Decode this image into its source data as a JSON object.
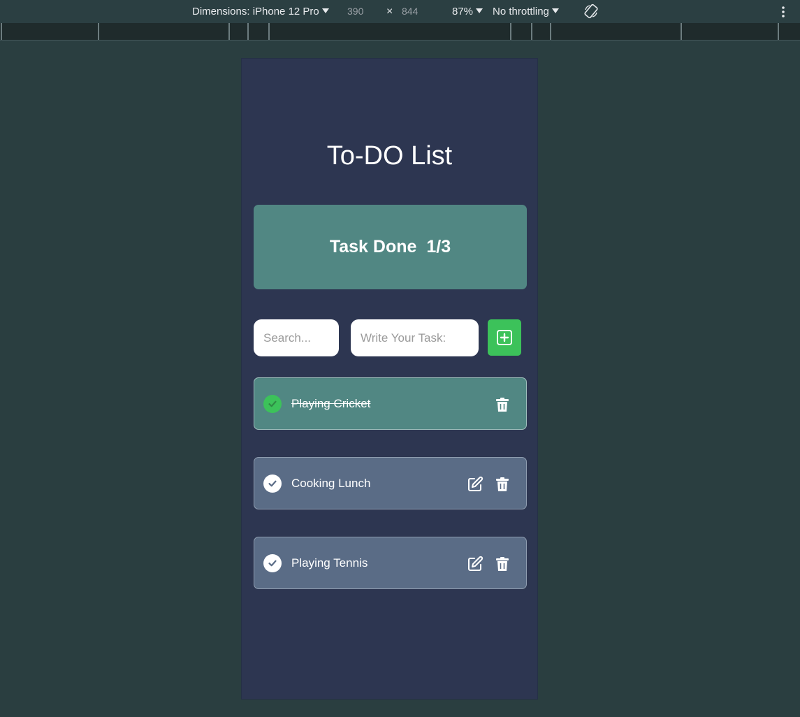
{
  "devtools": {
    "dimensions_label": "Dimensions: iPhone 12 Pro",
    "width": "390",
    "times": "×",
    "height": "844",
    "zoom": "87%",
    "throttling": "No throttling"
  },
  "app": {
    "title": "To-DO List",
    "stats": {
      "label": "Task Done",
      "count": "1/3"
    },
    "search": {
      "placeholder": "Search...",
      "value": ""
    },
    "task_input": {
      "placeholder": "Write Your Task:",
      "value": ""
    },
    "add_icon": "plus-square-icon",
    "tasks": [
      {
        "text": "Playing Cricket",
        "done": true
      },
      {
        "text": "Cooking Lunch",
        "done": false
      },
      {
        "text": "Playing Tennis",
        "done": false
      }
    ]
  },
  "colors": {
    "page_bg": "#2d3651",
    "card_done": "#518783",
    "card_pending": "#5a6c86",
    "accent_green": "#3cc25a"
  }
}
